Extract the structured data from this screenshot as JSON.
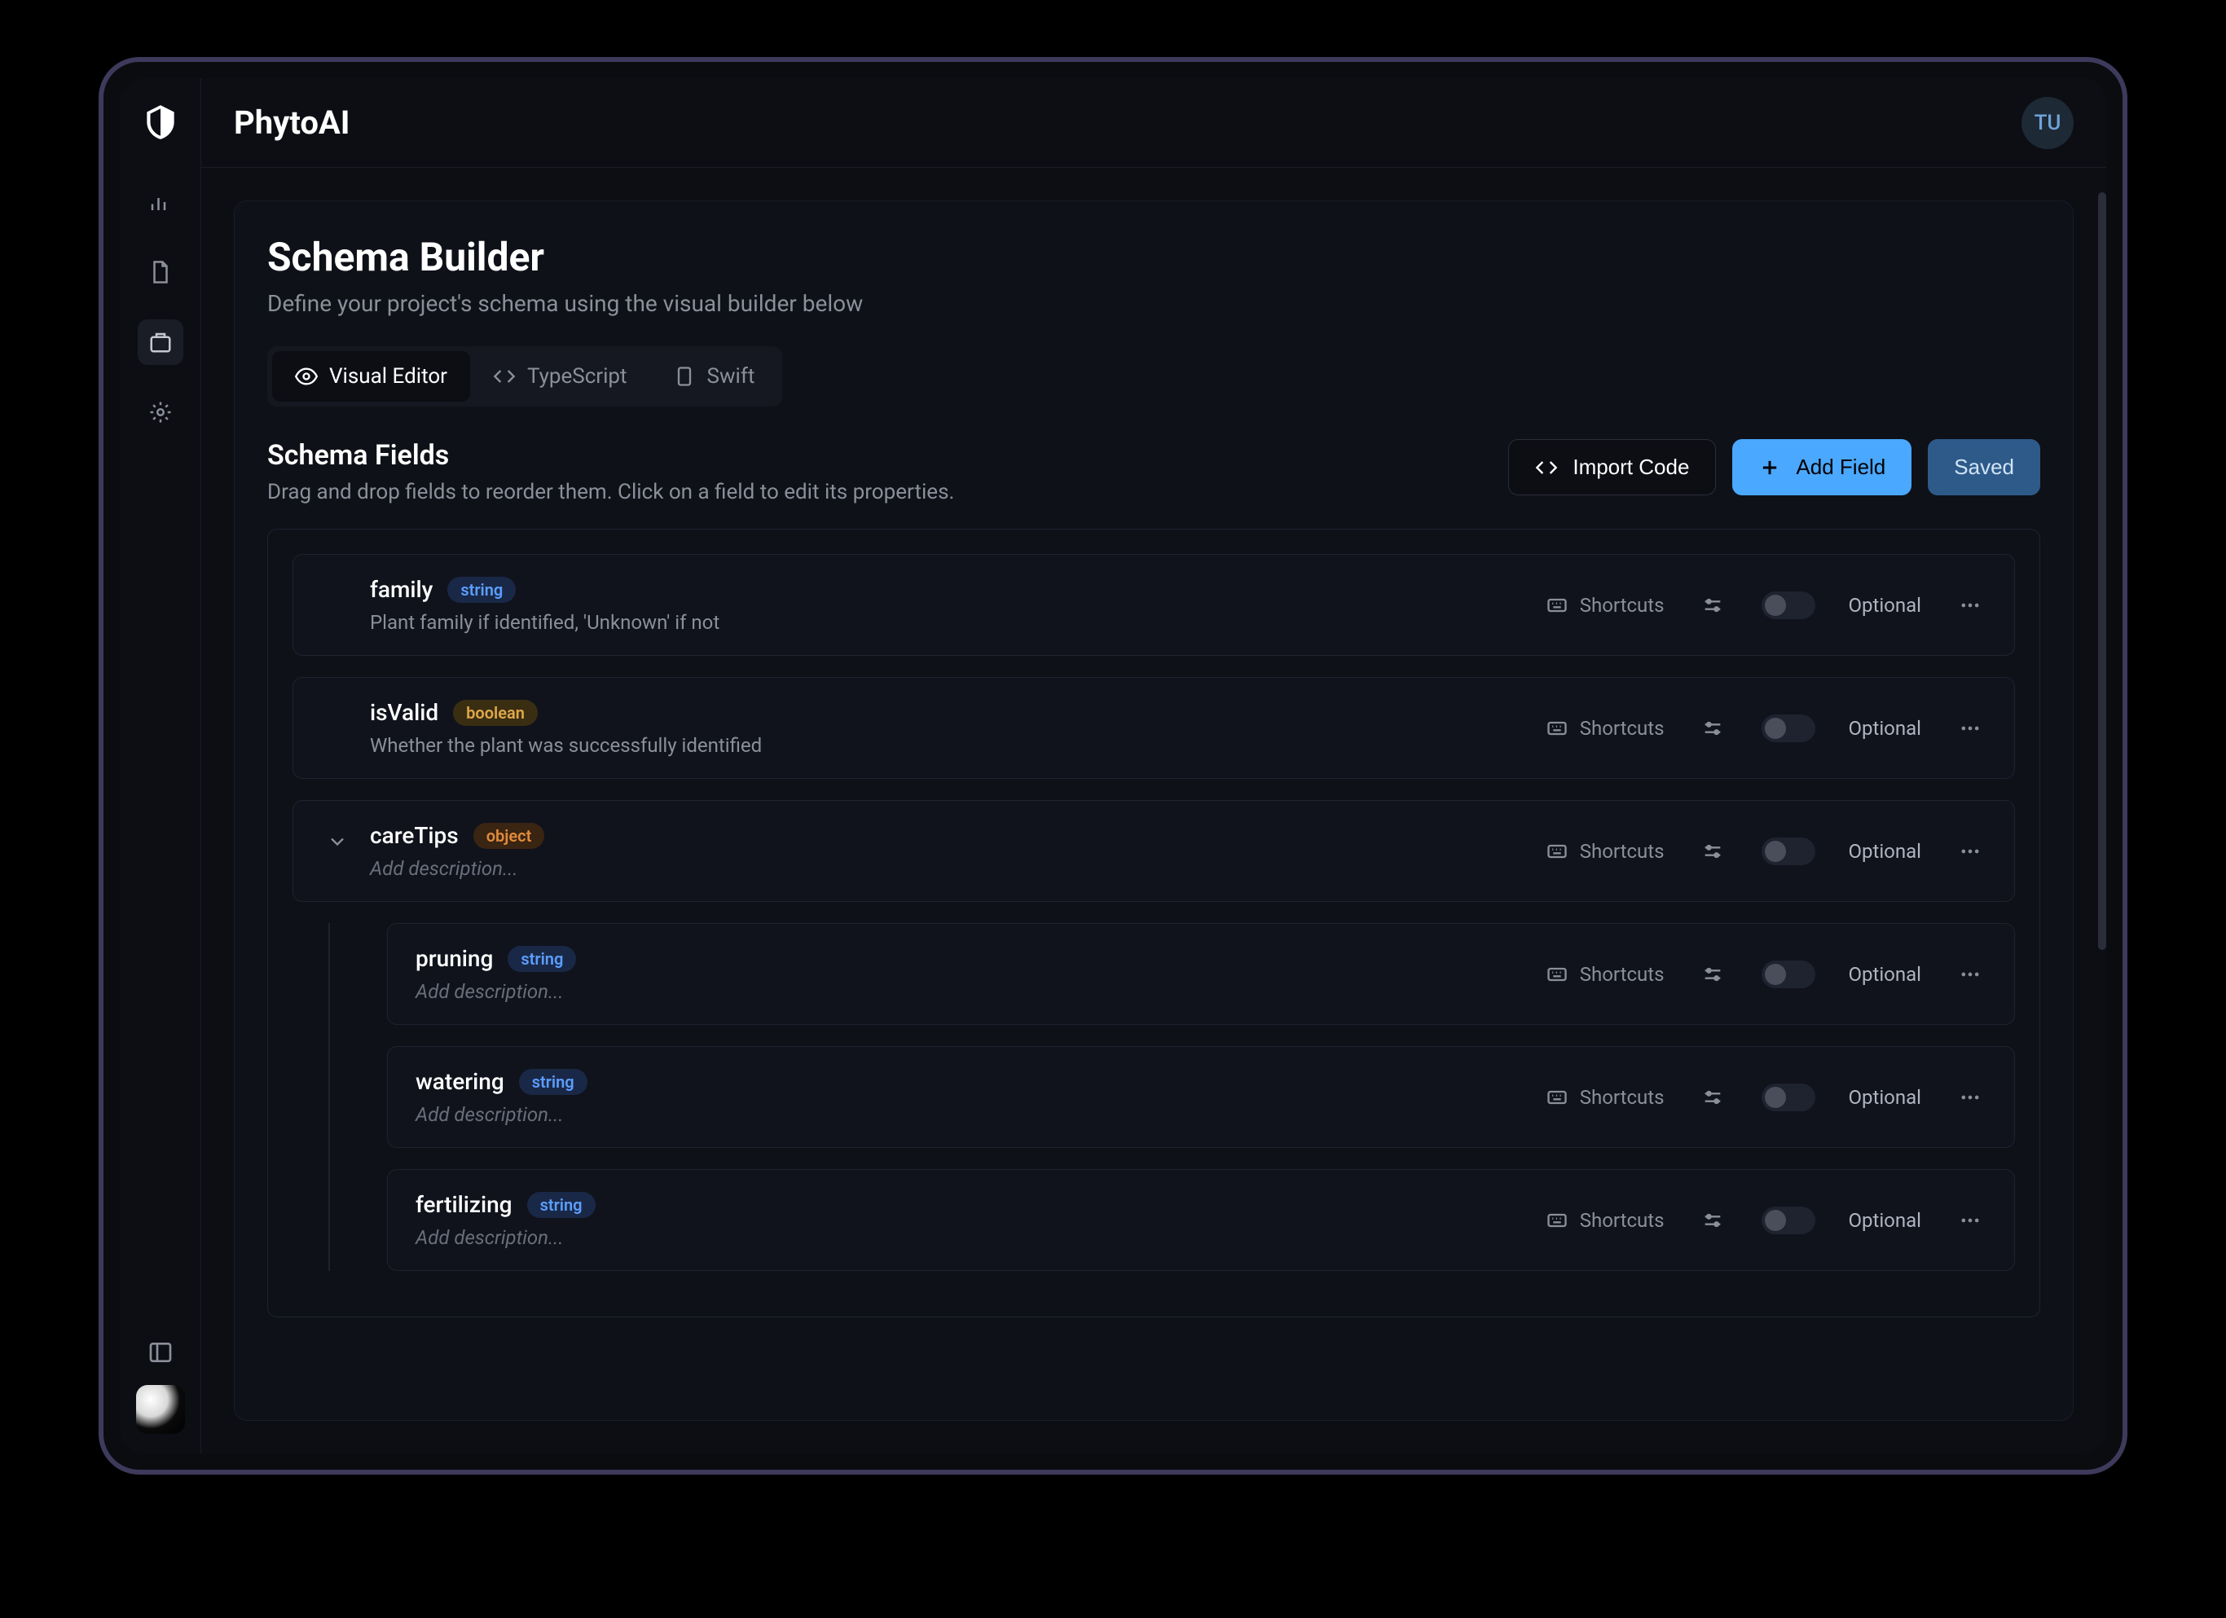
{
  "app": {
    "title": "PhytoAI",
    "avatar_initials": "TU"
  },
  "page": {
    "title": "Schema Builder",
    "subtitle": "Define your project's schema using the visual builder below"
  },
  "tabs": [
    {
      "label": "Visual Editor",
      "active": true
    },
    {
      "label": "TypeScript",
      "active": false
    },
    {
      "label": "Swift",
      "active": false
    }
  ],
  "section": {
    "title": "Schema Fields",
    "hint": "Drag and drop fields to reorder them. Click on a field to edit its properties."
  },
  "actions": {
    "import_label": "Import Code",
    "add_label": "Add Field",
    "saved_label": "Saved"
  },
  "field_common": {
    "shortcuts_label": "Shortcuts",
    "optional_label": "Optional",
    "desc_placeholder": "Add description..."
  },
  "fields": [
    {
      "name": "family",
      "type": "string",
      "description": "Plant family if identified, 'Unknown' if not"
    },
    {
      "name": "isValid",
      "type": "boolean",
      "description": "Whether the plant was successfully identified"
    },
    {
      "name": "careTips",
      "type": "object",
      "description": "",
      "expanded": true,
      "children": [
        {
          "name": "pruning",
          "type": "string",
          "description": ""
        },
        {
          "name": "watering",
          "type": "string",
          "description": ""
        },
        {
          "name": "fertilizing",
          "type": "string",
          "description": ""
        }
      ]
    }
  ]
}
